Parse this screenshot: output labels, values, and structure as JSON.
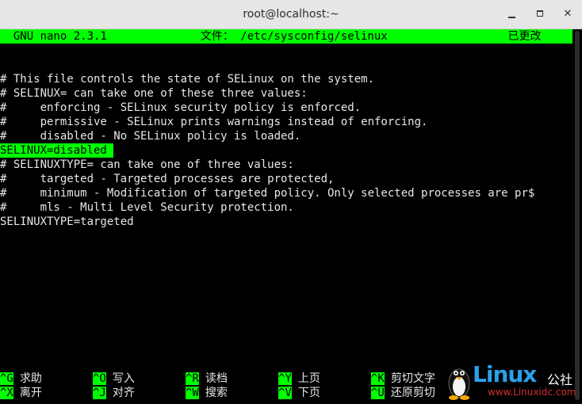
{
  "window": {
    "title": "root@localhost:~"
  },
  "nano": {
    "header": "  GNU nano 2.3.1              文件： /etc/sysconfig/selinux                  已更改"
  },
  "file_lines": [
    "# This file controls the state of SELinux on the system.",
    "# SELINUX= can take one of these three values:",
    "#     enforcing - SELinux security policy is enforced.",
    "#     permissive - SELinux prints warnings instead of enforcing.",
    "#     disabled - No SELinux policy is loaded.",
    "SELINUX=disabled ",
    "# SELINUXTYPE= can take one of three values:",
    "#     targeted - Targeted processes are protected,",
    "#     minimum - Modification of targeted policy. Only selected processes are pr$",
    "#     mls - Multi Level Security protection.",
    "SELINUXTYPE=targeted"
  ],
  "shortcuts": {
    "row1": [
      {
        "key": "^G",
        "label": "求助"
      },
      {
        "key": "^O",
        "label": "写入"
      },
      {
        "key": "^R",
        "label": "读档"
      },
      {
        "key": "^Y",
        "label": "上页"
      },
      {
        "key": "^K",
        "label": "剪切文字"
      }
    ],
    "row2": [
      {
        "key": "^X",
        "label": "离开"
      },
      {
        "key": "^J",
        "label": "对齐"
      },
      {
        "key": "^W",
        "label": "搜索"
      },
      {
        "key": "^V",
        "label": "下页"
      },
      {
        "key": "^U",
        "label": "还原剪切"
      }
    ]
  },
  "watermark": {
    "brand": "Linux",
    "cn": "公社",
    "url": "www.Linuxidc.com"
  },
  "colors": {
    "highlight": "#00ff00",
    "terminal_bg": "#000000",
    "terminal_fg": "#e8e8e8"
  }
}
